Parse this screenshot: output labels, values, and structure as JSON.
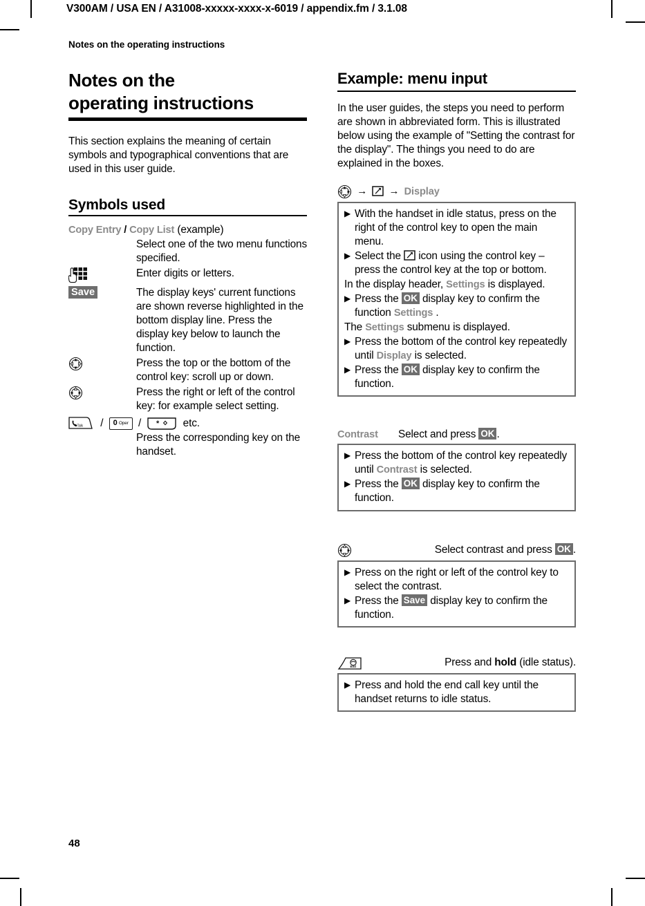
{
  "page": {
    "running_header": "V300AM / USA EN / A31008-xxxxx-xxxx-x-6019 / appendix.fm / 3.1.08",
    "section_header": "Notes on the operating instructions",
    "page_number": "48"
  },
  "left_column": {
    "title_line1": "Notes on the",
    "title_line2": "operating instructions",
    "intro": "This section explains the meaning of certain symbols and typographical conventions that are used in this user guide.",
    "symbols_heading": "Symbols used",
    "symbols": [
      {
        "key_type": "text",
        "key_label_a": "Copy Entry",
        "key_sep": "/",
        "key_label_b": "Copy List",
        "key_suffix": "(example)",
        "description": "Select one of the two menu functions specified."
      },
      {
        "key_type": "keypad-icon",
        "icon_name": "keypad-icon",
        "description": "Enter digits or letters."
      },
      {
        "key_type": "chip",
        "chip_label": "Save",
        "description": "The display keys' current functions are shown reverse highlighted in the bottom display line. Press the display key below to launch the function."
      },
      {
        "key_type": "control-key-vertical",
        "icon_name": "control-key-up-down-icon",
        "description": "Press the top or the bottom of the control key: scroll up or down."
      },
      {
        "key_type": "control-key-horizontal",
        "icon_name": "control-key-left-right-icon",
        "description": "Press the right or left of the control key: for example select setting."
      },
      {
        "key_type": "handset-keys",
        "keys": [
          "talk-key",
          "zero-oper-key",
          "star-key"
        ],
        "key_zero_main": "0",
        "key_zero_sub": "Oper",
        "key_talk_sub": "Talk",
        "key_star_main": "∗",
        "etc_label": "etc.",
        "description": "Press the corresponding key on the handset."
      }
    ]
  },
  "right_column": {
    "title": "Example: menu input",
    "intro": "In the user guides, the steps you need to perform are shown in abbreviated form. This is illustrated below using the example of \"Setting the contrast for the display\". The things you need to do are explained in the boxes.",
    "nav_path": {
      "start_icon": "control-key-icon",
      "arrow": "→",
      "menu_icon": "settings-menu-icon",
      "destination": "Display"
    },
    "box1": {
      "steps": [
        {
          "type": "bullet",
          "parts": [
            {
              "t": "With the handset in idle status, press on the right of the control key to open the main menu.",
              "style": "plain"
            }
          ]
        },
        {
          "type": "bullet",
          "parts": [
            {
              "t": "Select the ",
              "style": "plain"
            },
            {
              "t": "settings-menu-icon",
              "style": "icon"
            },
            {
              "t": " icon using the control key – press the control key at the top or bottom.",
              "style": "plain"
            }
          ]
        },
        {
          "type": "note",
          "parts": [
            {
              "t": "In the display header, ",
              "style": "plain"
            },
            {
              "t": "Settings",
              "style": "gray"
            },
            {
              "t": " is displayed.",
              "style": "plain"
            }
          ]
        },
        {
          "type": "bullet",
          "parts": [
            {
              "t": "Press the ",
              "style": "plain"
            },
            {
              "t": "OK",
              "style": "chip"
            },
            {
              "t": " display key to confirm the function ",
              "style": "plain"
            },
            {
              "t": "Settings",
              "style": "gray"
            },
            {
              "t": " .",
              "style": "plain"
            }
          ]
        },
        {
          "type": "note",
          "parts": [
            {
              "t": "The ",
              "style": "plain"
            },
            {
              "t": "Settings",
              "style": "gray"
            },
            {
              "t": " submenu is displayed.",
              "style": "plain"
            }
          ]
        },
        {
          "type": "bullet",
          "parts": [
            {
              "t": "Press the bottom of the control key repeatedly until ",
              "style": "plain"
            },
            {
              "t": "Display",
              "style": "gray"
            },
            {
              "t": " is selected.",
              "style": "plain"
            }
          ]
        },
        {
          "type": "bullet",
          "parts": [
            {
              "t": "Press the ",
              "style": "plain"
            },
            {
              "t": "OK",
              "style": "chip"
            },
            {
              "t": " display key to confirm the function.",
              "style": "plain"
            }
          ]
        }
      ]
    },
    "step2": {
      "label": "Contrast",
      "instruction_pre": "Select and press ",
      "instruction_chip": "OK",
      "instruction_post": ".",
      "box": {
        "steps": [
          {
            "type": "bullet",
            "parts": [
              {
                "t": "Press the bottom of the control key repeatedly until ",
                "style": "plain"
              },
              {
                "t": "Contrast",
                "style": "gray"
              },
              {
                "t": " is selected.",
                "style": "plain"
              }
            ]
          },
          {
            "type": "bullet",
            "parts": [
              {
                "t": "Press the ",
                "style": "plain"
              },
              {
                "t": "OK",
                "style": "chip"
              },
              {
                "t": " display key to confirm the function.",
                "style": "plain"
              }
            ]
          }
        ]
      }
    },
    "step3": {
      "label_icon": "control-key-left-right-icon",
      "instruction_pre": "Select contrast and press ",
      "instruction_chip": "OK",
      "instruction_post": ".",
      "box": {
        "steps": [
          {
            "type": "bullet",
            "parts": [
              {
                "t": "Press on the right or left of the control key to select the contrast.",
                "style": "plain"
              }
            ]
          },
          {
            "type": "bullet",
            "parts": [
              {
                "t": "Press the ",
                "style": "plain"
              },
              {
                "t": "Save",
                "style": "chip"
              },
              {
                "t": " display key to confirm the function.",
                "style": "plain"
              }
            ]
          }
        ]
      }
    },
    "step4": {
      "label_icon": "end-call-key-icon",
      "instruction_pre": "Press and ",
      "instruction_bold": "hold",
      "instruction_post": " (idle status).",
      "box": {
        "steps": [
          {
            "type": "bullet",
            "parts": [
              {
                "t": "Press and hold the end call key until the handset returns to idle status.",
                "style": "plain"
              }
            ]
          }
        ]
      }
    }
  },
  "colors": {
    "gray_text": "#8a8a8a",
    "chip_bg": "#6e6e6e",
    "box_border": "#6b6b6b",
    "rule": "#000000"
  }
}
